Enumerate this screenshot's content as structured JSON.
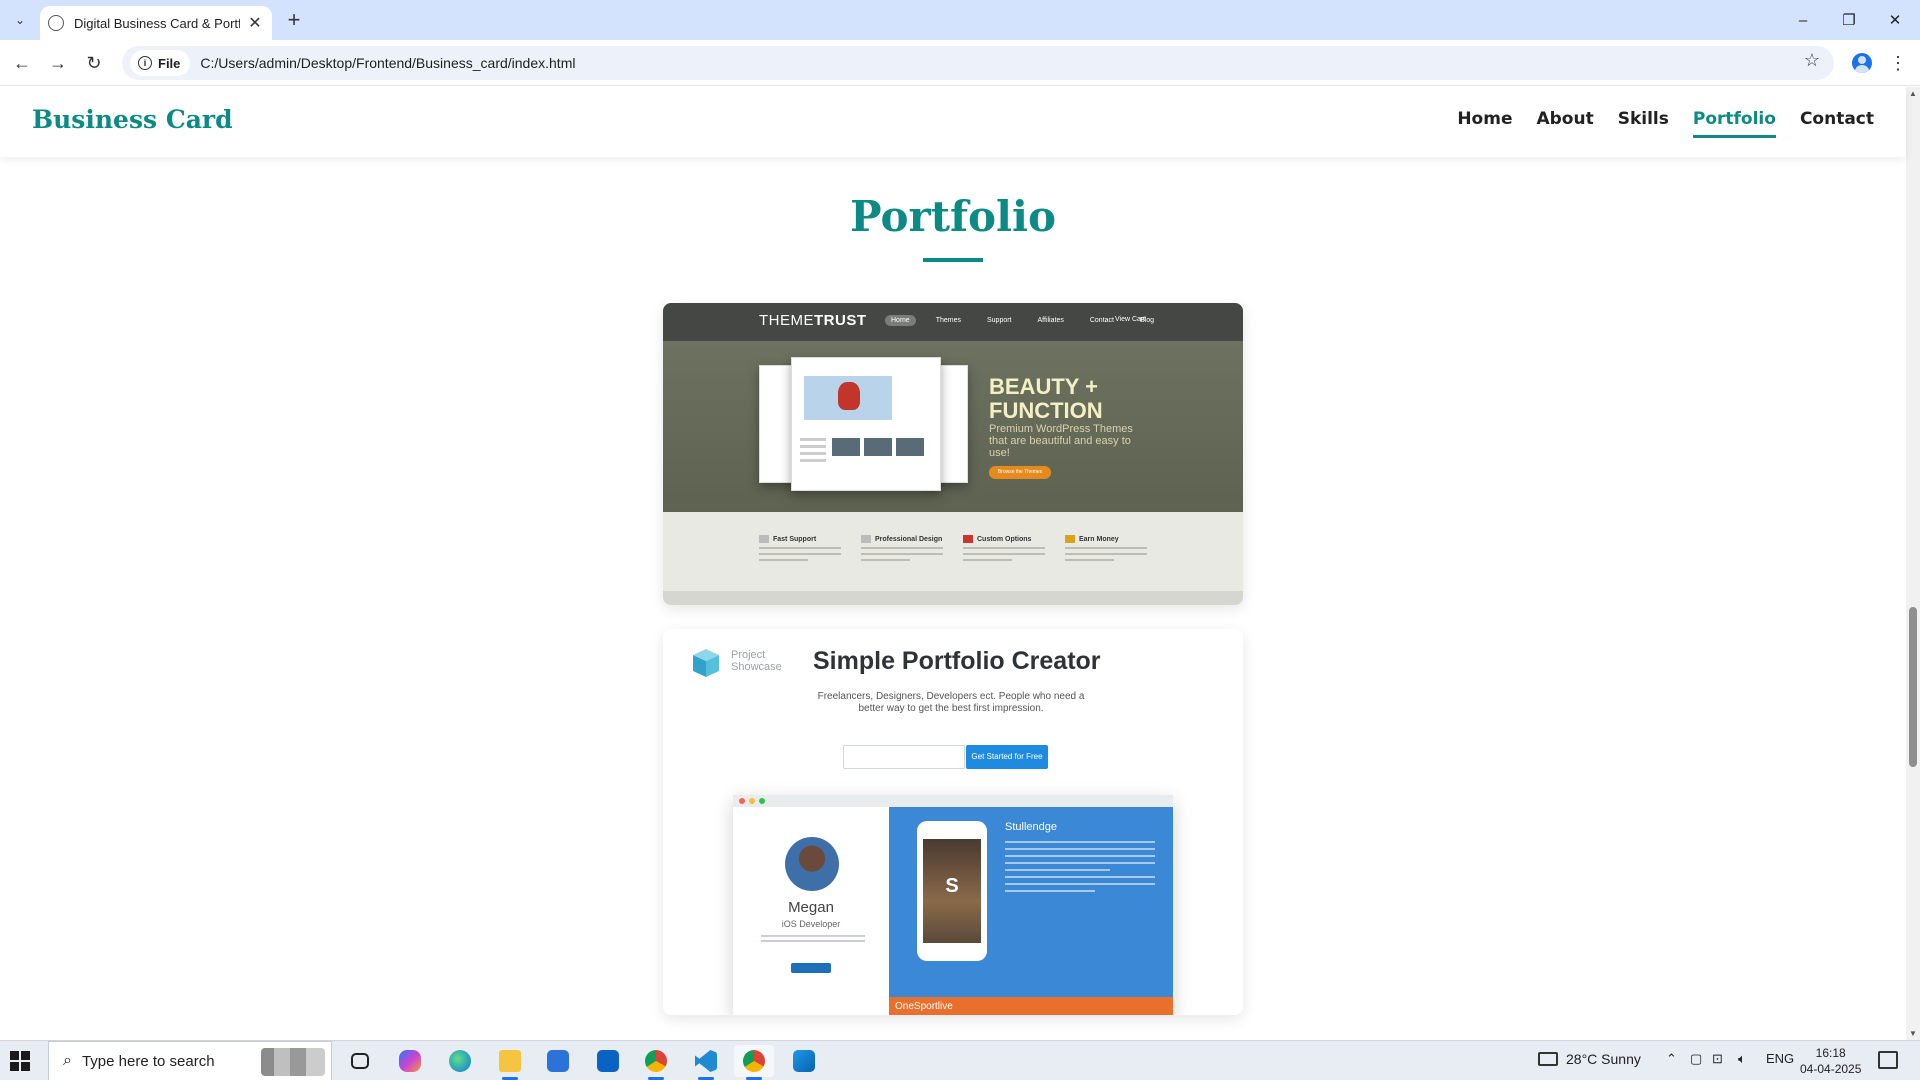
{
  "browser": {
    "tab_title": "Digital Business Card & Portfolio",
    "tab_close": "✕",
    "new_tab": "+",
    "url_chip": "File",
    "url": "C:/Users/admin/Desktop/Frontend/Business_card/index.html",
    "window_controls": {
      "minimize": "–",
      "maximize": "❐",
      "close": "✕"
    }
  },
  "site": {
    "brand": "Business Card",
    "nav": [
      {
        "label": "Home",
        "active": false
      },
      {
        "label": "About",
        "active": false
      },
      {
        "label": "Skills",
        "active": false
      },
      {
        "label": "Portfolio",
        "active": true
      },
      {
        "label": "Contact",
        "active": false
      }
    ],
    "section_title": "Portfolio"
  },
  "portfolio": {
    "card1": {
      "logo_light": "THEME",
      "logo_bold": "TRUST",
      "nav": [
        "Home",
        "Themes",
        "Support",
        "Affiliates",
        "Contact",
        "Blog"
      ],
      "cart": "View Cart",
      "headline_1": "BEAUTY +",
      "headline_2": "FUNCTION",
      "subhead": "Premium WordPress Themes that are beautiful and easy to use!",
      "cta": "Browse the Themes",
      "features": [
        "Fast Support",
        "Professional Design",
        "Custom Options",
        "Earn Money"
      ]
    },
    "card2": {
      "logo_text_1": "Project",
      "logo_text_2": "Showcase",
      "headline": "Simple Portfolio Creator",
      "description": "Freelancers, Designers, Developers ect. People who need a better way to get the best first impression.",
      "cta": "Get Started for Free",
      "profile_name": "Megan",
      "profile_role": "iOS Developer",
      "phone_letter": "S",
      "blue_title": "Stullendge",
      "orange_label": "OneSportlive"
    }
  },
  "taskbar": {
    "search_placeholder": "Type here to search",
    "weather": "28°C  Sunny",
    "language": "ENG",
    "time": "16:18",
    "date": "04-04-2025"
  },
  "colors": {
    "accent": "#0c8a86",
    "tabstrip": "#d3e3fd",
    "chrome_blue": "#1a73e8"
  }
}
